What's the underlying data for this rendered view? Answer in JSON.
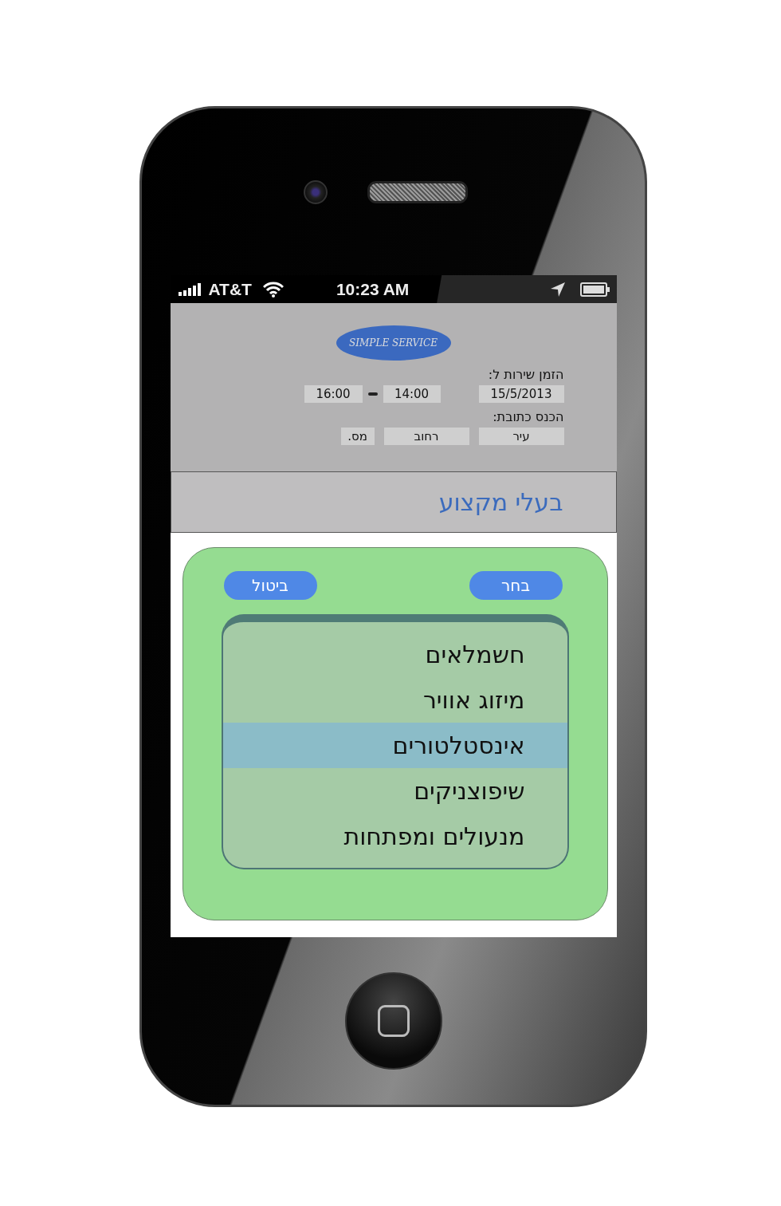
{
  "status_bar": {
    "carrier": "AT&T",
    "time": "10:23 AM"
  },
  "logo": "SIMPLE SERVICE",
  "service_time": {
    "label": "הזמן שירות ל:",
    "date": "15/5/2013",
    "from": "14:00",
    "to": "16:00"
  },
  "address": {
    "label": "הכנס כתובת:",
    "fields": [
      {
        "placeholder": "עיר"
      },
      {
        "placeholder": "רחוב"
      },
      {
        "placeholder": "מס."
      }
    ]
  },
  "title": "בעלי מקצוע",
  "picker": {
    "confirm": "בחר",
    "cancel": "ביטול",
    "items": [
      {
        "label": "חשמלאים",
        "selected": false
      },
      {
        "label": "מיזוג אוויר",
        "selected": false
      },
      {
        "label": "אינסטלטורים",
        "selected": true
      },
      {
        "label": "שיפוצניקים",
        "selected": false
      },
      {
        "label": "מנעולים ומפתחות",
        "selected": false
      }
    ]
  }
}
